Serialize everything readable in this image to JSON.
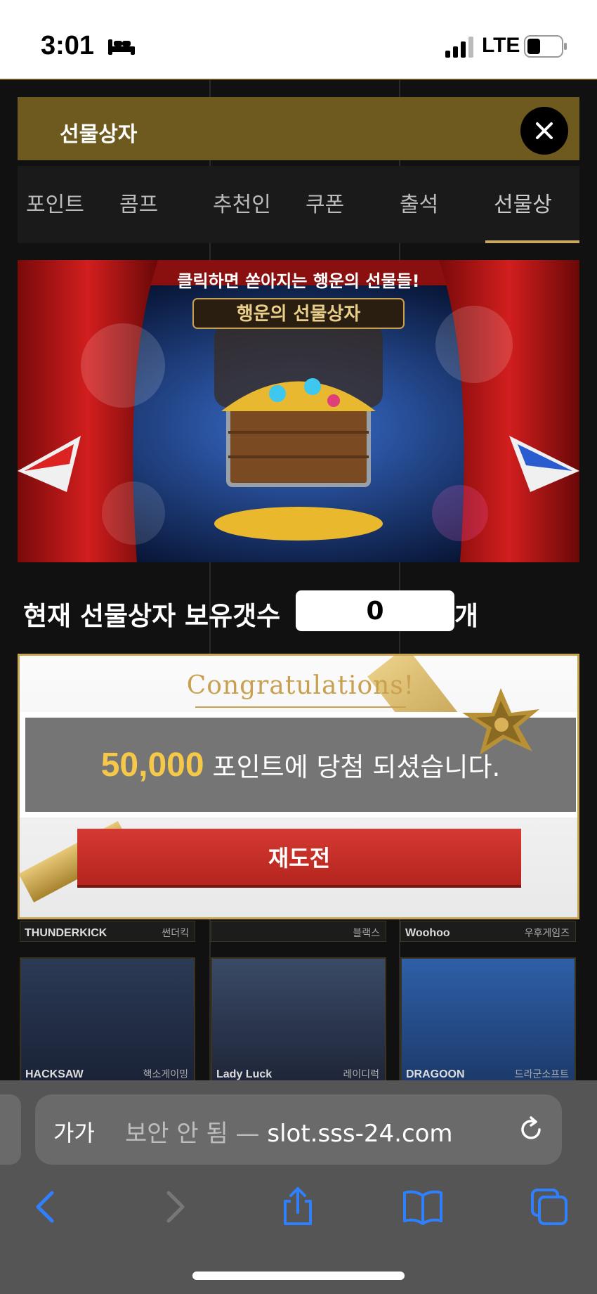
{
  "status_bar": {
    "time": "3:01",
    "network": "LTE"
  },
  "modal": {
    "title": "선물상자",
    "tabs": [
      "포인트",
      "콤프",
      "추천인",
      "쿠폰",
      "출석",
      "선물상"
    ],
    "active_tab_index": 5,
    "banner": {
      "top_text": "클릭하면 쏟아지는 행운의 선물들!",
      "sign_text": "행운의 선물상자"
    },
    "count": {
      "label": "현재 선물상자 보유갯수",
      "value": "0",
      "unit": "개"
    },
    "prize": {
      "congrats": "Congratulations!",
      "amount": "50,000",
      "message": "포인트에 당첨 되셨습니다.",
      "retry_label": "재도전"
    }
  },
  "background_site": {
    "providers": [
      "THUNDERKICK",
      "Woohoo",
      "HACKSAW",
      "Lady Luck",
      "DRAGOON"
    ],
    "provider_subs": [
      "썬더킥",
      "블랙스",
      "우후게임즈",
      "핵소게이밍",
      "레이디럭",
      "드라군소프트"
    ]
  },
  "browser": {
    "aa": "가가",
    "url_insecure": "보안 안 됨 —",
    "url_domain": "slot.sss-24.com"
  }
}
